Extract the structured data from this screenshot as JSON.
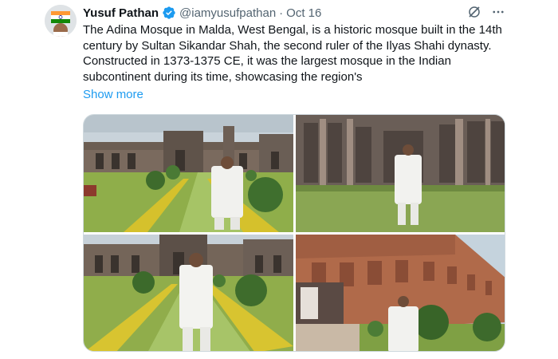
{
  "tweet": {
    "author_name": "Yusuf Pathan",
    "handle": "@iamyusufpathan",
    "separator": "·",
    "date": "Oct 16",
    "text": "The Adina Mosque in Malda, West Bengal, is a historic mosque built in the 14th century by Sultan Sikandar Shah, the second ruler of the Ilyas Shahi dynasty. Constructed in 1373-1375 CE, it was the largest mosque in the Indian subcontinent during its time, showcasing the region's",
    "show_more": "Show more",
    "verified_icon": "verified-badge-icon",
    "grok_icon": "grok-icon",
    "more_icon": "more-options-icon",
    "accent_color": "#1d9bf0"
  },
  "media": [
    {
      "name": "photo-1",
      "description_icon": "photo"
    },
    {
      "name": "photo-2",
      "description_icon": "photo"
    },
    {
      "name": "photo-3",
      "description_icon": "photo"
    },
    {
      "name": "photo-4",
      "description_icon": "photo"
    }
  ]
}
